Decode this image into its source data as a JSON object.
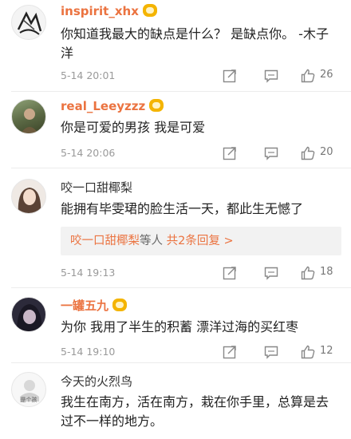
{
  "comments": [
    {
      "username": "inspirit_xhx",
      "text": "你知道我最大的缺点是什么？ 是缺点你。 -木子洋",
      "timestamp": "5-14 20:01",
      "likes": "26"
    },
    {
      "username": "real_Leeyzzz",
      "text": "你是可爱的男孩  我是可爱",
      "timestamp": "5-14 20:06",
      "likes": "20"
    },
    {
      "username": "咬一口甜椰梨",
      "text": "能拥有毕雯珺的脸生活一天，都此生无憾了",
      "timestamp": "5-14 19:13",
      "likes": "18",
      "replies": {
        "user": "咬一口甜椰梨",
        "middle": "等人",
        "count_label": "共2条回复",
        "arrow": ">"
      }
    },
    {
      "username": "一罐五九",
      "text": "为你 我用了半生的积蓄 漂洋过海的买红枣",
      "timestamp": "5-14 19:10",
      "likes": "12"
    },
    {
      "username": "今天的火烈鸟",
      "text": "我生在南方，活在南方，栽在你手里，总算是去过不一样的地方。",
      "avatar_caption": "是个孩"
    }
  ],
  "icons": {
    "share": "share-icon",
    "reply": "comment-icon",
    "like": "thumbs-up-icon",
    "badge": "vip-crown-icon"
  },
  "colors": {
    "vip_name": "#eb7340",
    "text": "#222222",
    "meta": "#9a9a9a",
    "reply_link": "#eb7340"
  }
}
